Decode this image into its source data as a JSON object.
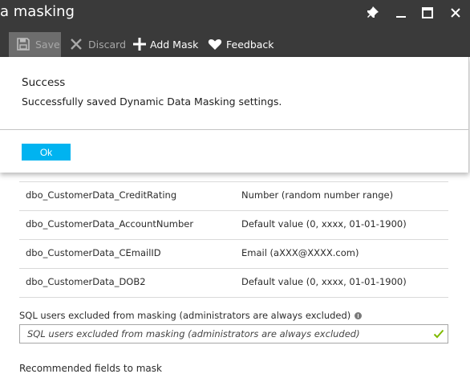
{
  "window": {
    "title": "a masking"
  },
  "toolbar": {
    "save_label": "Save",
    "discard_label": "Discard",
    "add_mask_label": "Add Mask",
    "feedback_label": "Feedback"
  },
  "dialog": {
    "title": "Success",
    "message": "Successfully saved Dynamic Data Masking settings.",
    "ok_label": "Ok"
  },
  "mask_rules": [
    {
      "field": "dbo_CustomerData_CreditRating",
      "mask": "Number (random number range)"
    },
    {
      "field": "dbo_CustomerData_AccountNumber",
      "mask": "Default value (0, xxxx, 01-01-1900)"
    },
    {
      "field": "dbo_CustomerData_CEmailID",
      "mask": "Email (aXXX@XXXX.com)"
    },
    {
      "field": "dbo_CustomerData_DOB2",
      "mask": "Default value (0, xxxx, 01-01-1900)"
    }
  ],
  "excluded_users": {
    "label": "SQL users excluded from masking (administrators are always excluded)",
    "placeholder": "SQL users excluded from masking (administrators are always excluded)"
  },
  "cutoff_section": {
    "label": "Recommended fields to mask"
  },
  "colors": {
    "accent": "#00b3f0",
    "header_bg": "#3a3a3a",
    "valid_check": "#7fba00"
  }
}
